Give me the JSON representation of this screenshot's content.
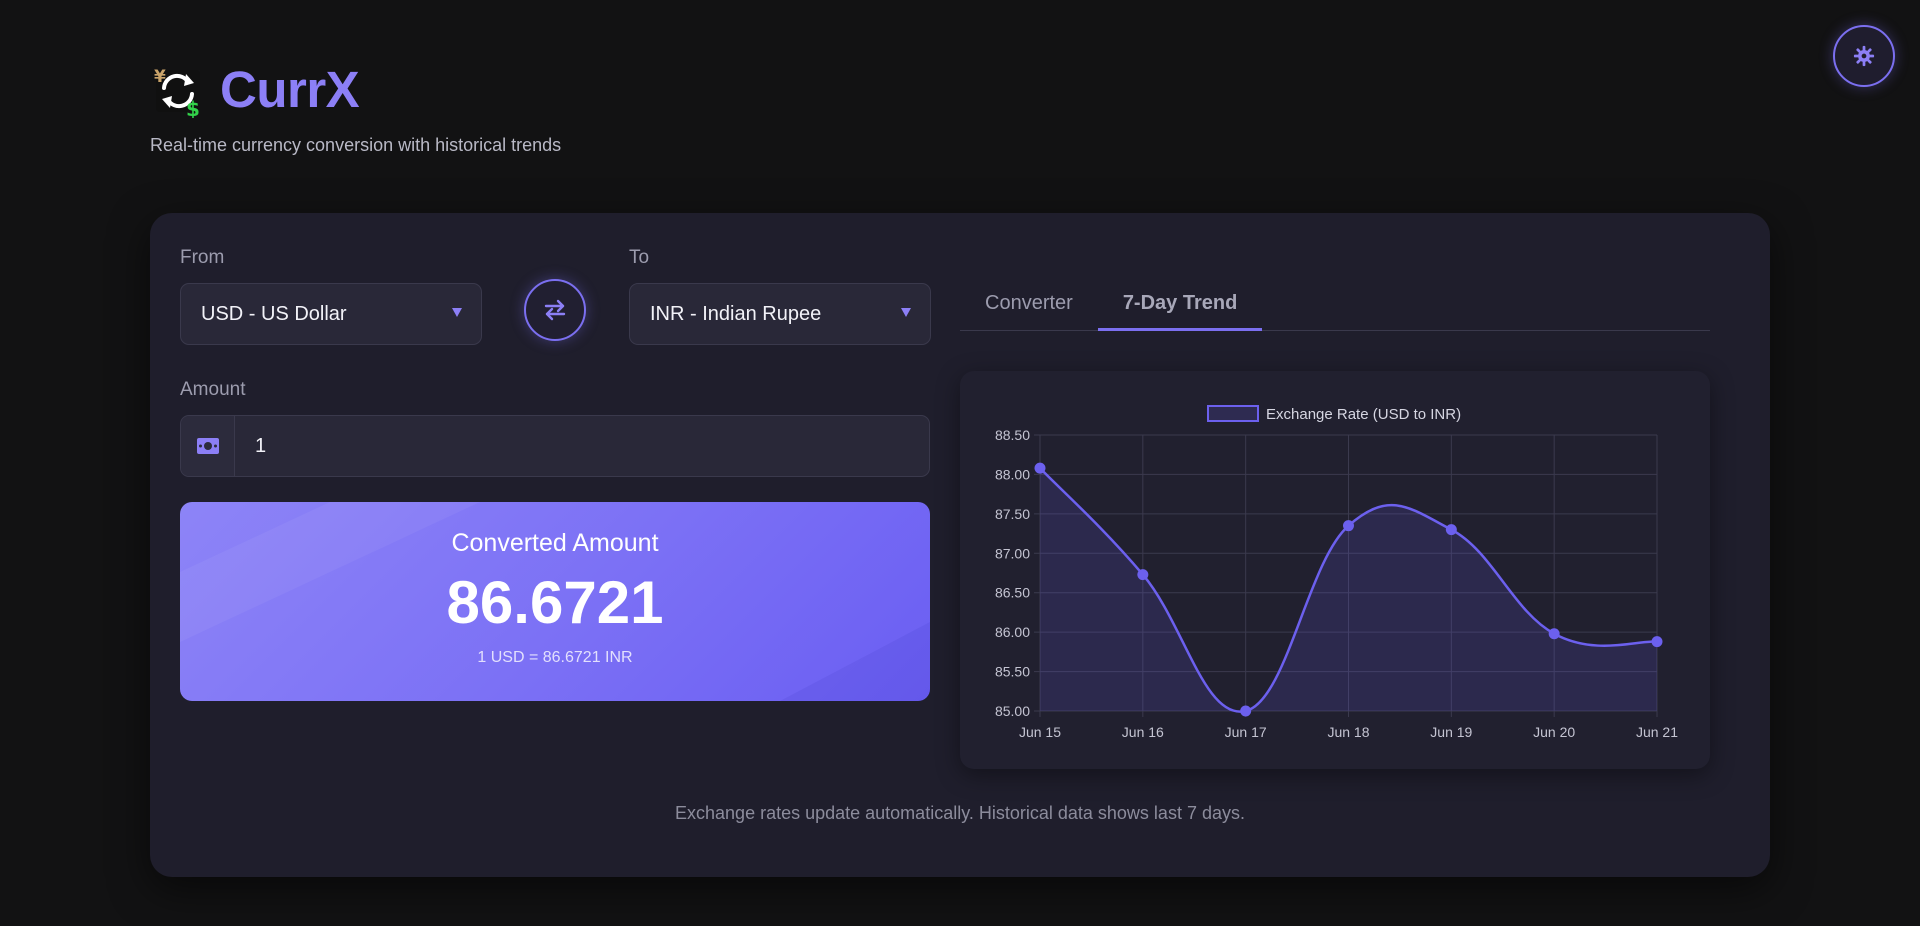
{
  "app": {
    "name": "CurrX",
    "tagline": "Real-time currency conversion with historical trends"
  },
  "theme_toggle": {
    "icon": "gear-icon"
  },
  "converter": {
    "from_label": "From",
    "from_value": "USD - US Dollar",
    "to_label": "To",
    "to_value": "INR - Indian Rupee",
    "amount_label": "Amount",
    "amount_value": "1",
    "amount_icon": "money-icon",
    "swap_icon": "swap-arrows-icon"
  },
  "result": {
    "title": "Converted Amount",
    "value": "86.6721",
    "rate_text": "1 USD = 86.6721 INR"
  },
  "tabs": [
    {
      "label": "Converter",
      "active": false
    },
    {
      "label": "7-Day Trend",
      "active": true
    }
  ],
  "footer_note": "Exchange rates update automatically. Historical data shows last 7 days.",
  "colors": {
    "accent": "#7b6ff0",
    "brand": "#8c7ff6",
    "line": "#6c60ee",
    "background": "#121213",
    "card": "#1f1e2c"
  },
  "chart_data": {
    "type": "line",
    "categories": [
      "Jun 15",
      "Jun 16",
      "Jun 17",
      "Jun 18",
      "Jun 19",
      "Jun 20",
      "Jun 21"
    ],
    "series": [
      {
        "name": "Exchange Rate (USD to INR)",
        "values": [
          88.08,
          86.73,
          85.0,
          87.35,
          87.3,
          85.98,
          85.88
        ]
      }
    ],
    "ylim": [
      85.0,
      88.5
    ],
    "yticks": [
      "85.00",
      "85.50",
      "86.00",
      "86.50",
      "87.00",
      "87.50",
      "88.00",
      "88.50"
    ],
    "legend_position": "top",
    "grid": true,
    "fill": true,
    "smooth": true
  }
}
